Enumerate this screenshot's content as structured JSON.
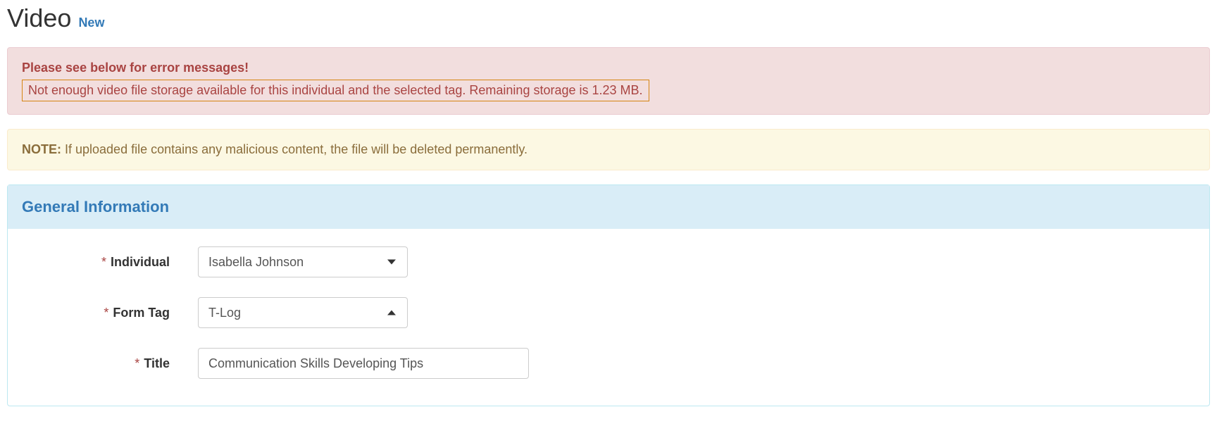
{
  "header": {
    "title": "Video",
    "subtitle": "New"
  },
  "error_alert": {
    "heading": "Please see below for error messages!",
    "message": "Not enough video file storage available for this individual and the selected tag. Remaining storage is 1.23 MB."
  },
  "warning_alert": {
    "label": "NOTE:",
    "text": " If uploaded file contains any malicious content, the file will be deleted permanently."
  },
  "panel": {
    "title": "General Information"
  },
  "form": {
    "required_mark": "*",
    "individual": {
      "label": "Individual",
      "value": "Isabella Johnson"
    },
    "form_tag": {
      "label": "Form Tag",
      "value": "T-Log"
    },
    "title_field": {
      "label": "Title",
      "value": "Communication Skills Developing Tips"
    }
  }
}
